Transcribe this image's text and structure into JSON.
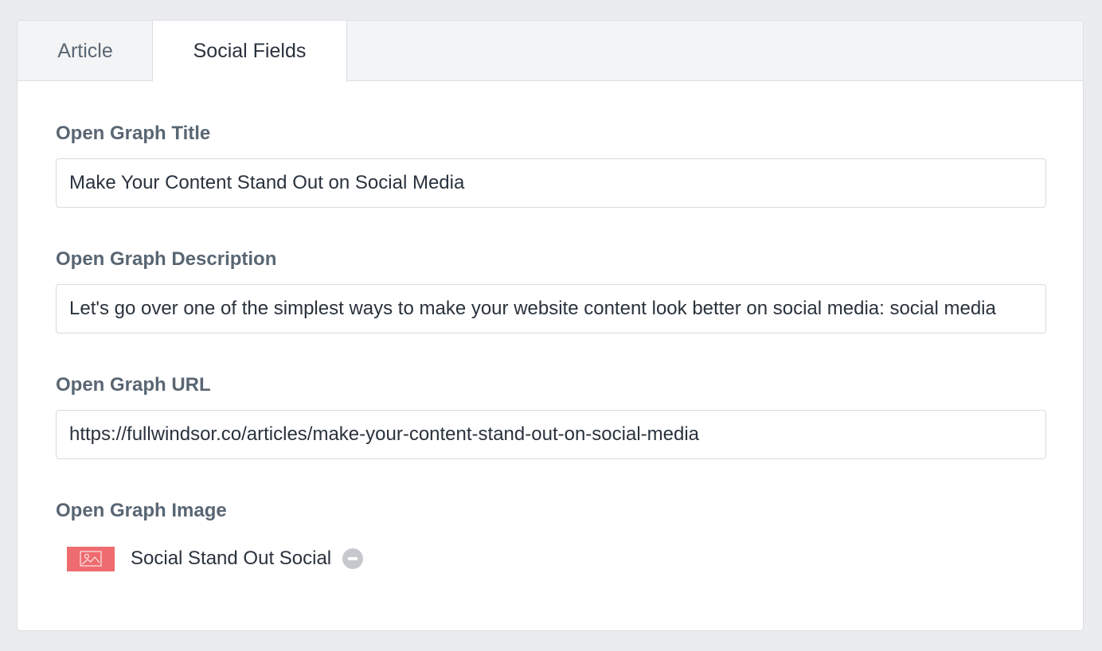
{
  "tabs": {
    "article_label": "Article",
    "social_label": "Social Fields"
  },
  "fields": {
    "og_title": {
      "label": "Open Graph Title",
      "value": "Make Your Content Stand Out on Social Media"
    },
    "og_description": {
      "label": "Open Graph Description",
      "value": "Let's go over one of the simplest ways to make your website content look better on social media: social media"
    },
    "og_url": {
      "label": "Open Graph URL",
      "value": "https://fullwindsor.co/articles/make-your-content-stand-out-on-social-media"
    },
    "og_image": {
      "label": "Open Graph Image",
      "filename": "Social Stand Out Social",
      "thumb_icon": "image-icon",
      "remove_icon": "remove-icon"
    }
  },
  "colors": {
    "page_background": "#ebeced",
    "label": "#596673",
    "text": "#29323d",
    "thumbnail": "#ee6b6f",
    "remove_button": "#c5c9cd"
  }
}
